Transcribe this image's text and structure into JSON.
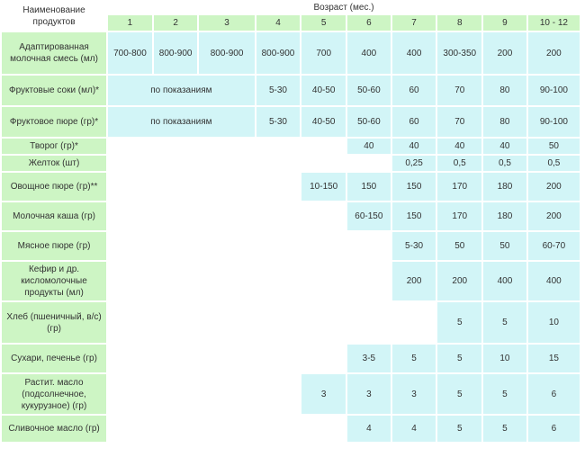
{
  "table": {
    "name_header": "Наименование продуктов",
    "age_header": "Возраст (мес.)",
    "ages": [
      "1",
      "2",
      "3",
      "4",
      "5",
      "6",
      "7",
      "8",
      "9",
      "10 - 12"
    ],
    "rows": [
      {
        "name": "Адаптированная молочная смесь (мл)",
        "cells": [
          {
            "text": "700-800"
          },
          {
            "text": "800-900"
          },
          {
            "text": "800-900"
          },
          {
            "text": "800-900"
          },
          {
            "text": "700"
          },
          {
            "text": "400"
          },
          {
            "text": "400"
          },
          {
            "text": "300-350"
          },
          {
            "text": "200"
          },
          {
            "text": "200"
          }
        ]
      },
      {
        "name": "Фруктовые соки (мл)*",
        "cells": [
          {
            "text": "по показаниям",
            "span": 3
          },
          {
            "text": "5-30"
          },
          {
            "text": "40-50"
          },
          {
            "text": "50-60"
          },
          {
            "text": "60"
          },
          {
            "text": "70"
          },
          {
            "text": "80"
          },
          {
            "text": "90-100"
          }
        ]
      },
      {
        "name": "Фруктовое пюре (гр)*",
        "cells": [
          {
            "text": "по показаниям",
            "span": 3
          },
          {
            "text": "5-30"
          },
          {
            "text": "40-50"
          },
          {
            "text": "50-60"
          },
          {
            "text": "60"
          },
          {
            "text": "70"
          },
          {
            "text": "80"
          },
          {
            "text": "90-100"
          }
        ]
      },
      {
        "name": "Творог (гр)*",
        "cells": [
          {
            "text": "",
            "span": 5,
            "blank": true
          },
          {
            "text": "40"
          },
          {
            "text": "40"
          },
          {
            "text": "40"
          },
          {
            "text": "40"
          },
          {
            "text": "50"
          }
        ]
      },
      {
        "name": "Желток (шт)",
        "cells": [
          {
            "text": "",
            "span": 6,
            "blank": true
          },
          {
            "text": "0,25"
          },
          {
            "text": "0,5"
          },
          {
            "text": "0,5"
          },
          {
            "text": "0,5"
          }
        ]
      },
      {
        "name": "Овощное пюре (гр)**",
        "cells": [
          {
            "text": "",
            "span": 4,
            "blank": true
          },
          {
            "text": "10-150"
          },
          {
            "text": "150"
          },
          {
            "text": "150"
          },
          {
            "text": "170"
          },
          {
            "text": "180"
          },
          {
            "text": "200"
          }
        ]
      },
      {
        "name": "Молочная каша (гр)",
        "cells": [
          {
            "text": "",
            "span": 5,
            "blank": true
          },
          {
            "text": "60-150"
          },
          {
            "text": "150"
          },
          {
            "text": "170"
          },
          {
            "text": "180"
          },
          {
            "text": "200"
          }
        ]
      },
      {
        "name": "Мясное пюре (гр)",
        "cells": [
          {
            "text": "",
            "span": 6,
            "blank": true
          },
          {
            "text": "5-30"
          },
          {
            "text": "50"
          },
          {
            "text": "50"
          },
          {
            "text": "60-70"
          }
        ]
      },
      {
        "name": "Кефир и др. кисломолочные продукты (мл)",
        "cells": [
          {
            "text": "",
            "span": 6,
            "blank": true
          },
          {
            "text": "200"
          },
          {
            "text": "200"
          },
          {
            "text": "400"
          },
          {
            "text": "400"
          }
        ]
      },
      {
        "name": "Хлеб (пшеничный, в/с) (гр)",
        "cells": [
          {
            "text": "",
            "span": 7,
            "blank": true
          },
          {
            "text": "5"
          },
          {
            "text": "5"
          },
          {
            "text": "10"
          }
        ]
      },
      {
        "name": "Сухари, печенье (гр)",
        "cells": [
          {
            "text": "",
            "span": 5,
            "blank": true
          },
          {
            "text": "3-5"
          },
          {
            "text": "5"
          },
          {
            "text": "5"
          },
          {
            "text": "10"
          },
          {
            "text": "15"
          }
        ]
      },
      {
        "name": "Растит. масло (подсолнечное, кукурузное) (гр)",
        "cells": [
          {
            "text": "",
            "span": 4,
            "blank": true
          },
          {
            "text": "3"
          },
          {
            "text": "3"
          },
          {
            "text": "3"
          },
          {
            "text": "5"
          },
          {
            "text": "5"
          },
          {
            "text": "6"
          }
        ]
      },
      {
        "name": "Сливочное масло (гр)",
        "cells": [
          {
            "text": "",
            "span": 5,
            "blank": true
          },
          {
            "text": "4"
          },
          {
            "text": "4"
          },
          {
            "text": "5"
          },
          {
            "text": "5"
          },
          {
            "text": "6"
          }
        ]
      }
    ]
  },
  "colors": {
    "header_green": "#cdf5c4",
    "value_cyan": "#d2f5f7",
    "text": "#333333"
  }
}
